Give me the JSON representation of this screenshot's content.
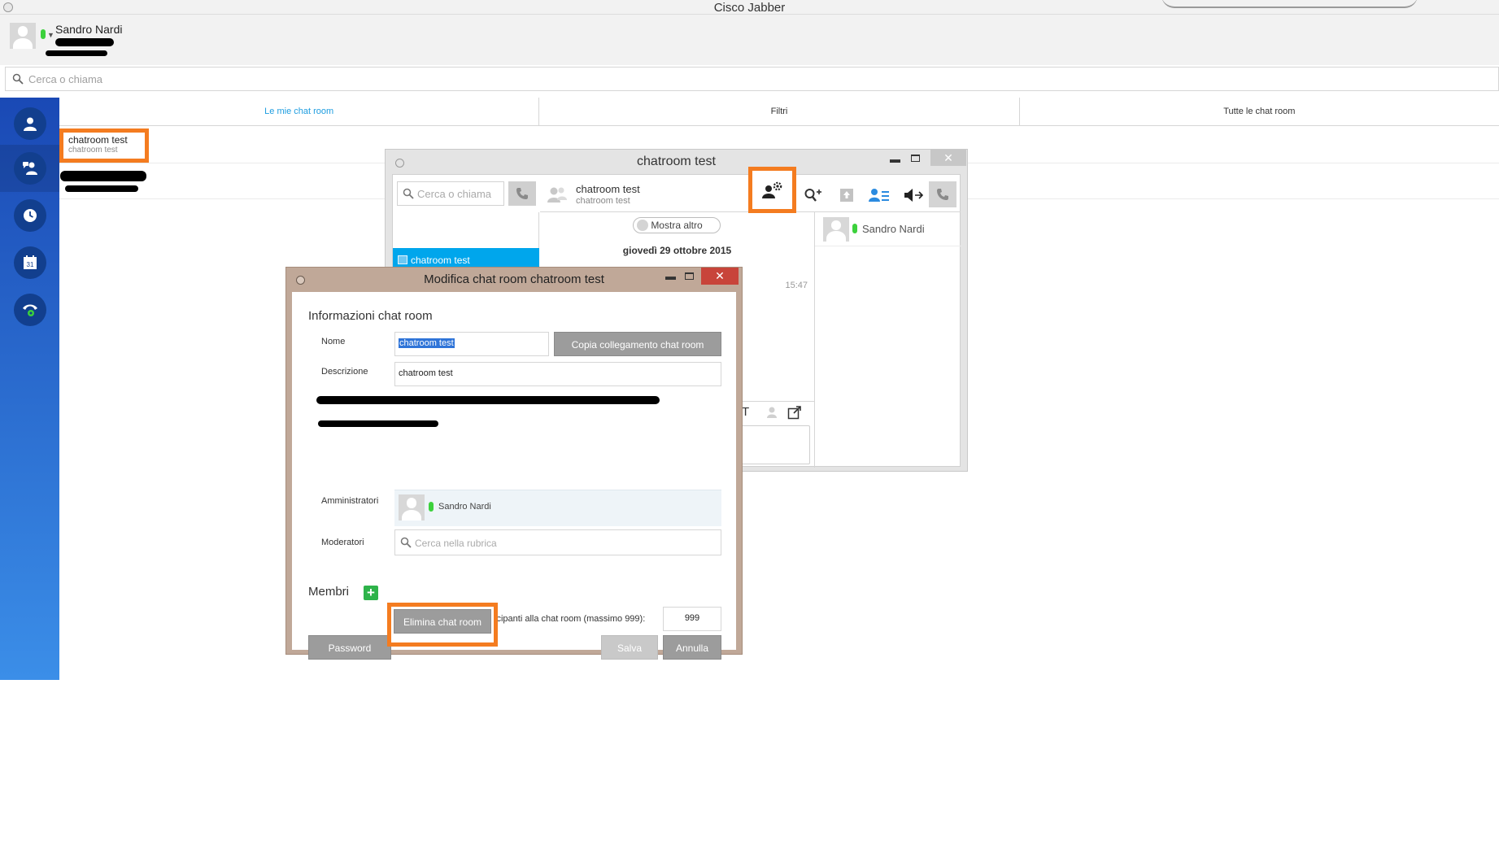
{
  "window": {
    "title": "Cisco Jabber"
  },
  "user": {
    "name": "Sandro Nardi"
  },
  "search": {
    "placeholder": "Cerca o chiama"
  },
  "tabs": [
    {
      "label": "Le mie chat room"
    },
    {
      "label": "Filtri"
    },
    {
      "label": "Tutte le chat room"
    }
  ],
  "room_list": [
    {
      "name": "chatroom test",
      "subtitle": "chatroom test"
    }
  ],
  "chat_window": {
    "title": "chatroom test",
    "search_placeholder": "Cerca o chiama",
    "selected_room": "chatroom test",
    "header_name": "chatroom test",
    "header_subtitle": "chatroom test",
    "show_more": "Mostra altro",
    "date": "giovedì 29 ottobre 2015",
    "time": "15:47",
    "participant": "Sandro Nardi"
  },
  "dialog": {
    "title": "Modifica chat room chatroom test",
    "section_info": "Informazioni chat room",
    "name_label": "Nome",
    "name_value": "chatroom test",
    "copy_link": "Copia collegamento chat room",
    "desc_label": "Descrizione",
    "desc_value": "chatroom test",
    "admins_label": "Amministratori",
    "admin_name": "Sandro Nardi",
    "mods_label": "Moderatori",
    "mods_placeholder": "Cerca nella rubrica",
    "members_label": "Membri",
    "limit_label": "Limite partecipanti alla chat room (massimo 999):",
    "limit_value": "999",
    "password": "Password",
    "delete": "Elimina chat room",
    "save": "Salva",
    "cancel": "Annulla"
  },
  "colors": {
    "accent_blue": "#1e9de0",
    "highlight_orange": "#f47c20",
    "presence_green": "#3cd13c",
    "rail_top": "#1a49b5",
    "rail_bottom": "#3b8ee8"
  }
}
